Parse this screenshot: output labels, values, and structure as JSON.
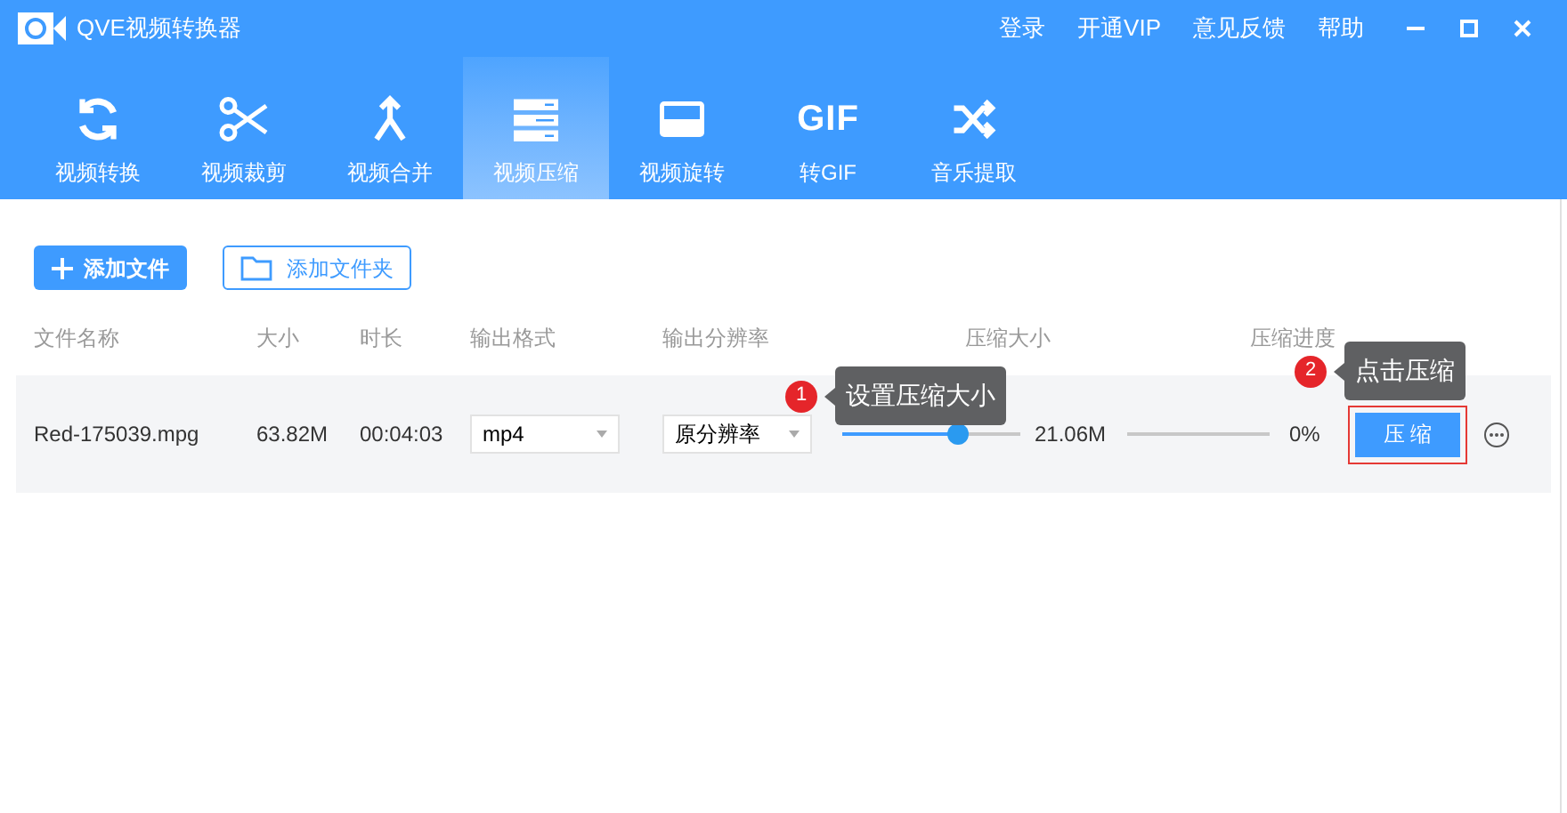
{
  "window": {
    "title": "QVE视频转换器",
    "links": [
      "登录",
      "开通VIP",
      "意见反馈",
      "帮助"
    ]
  },
  "tabs": [
    {
      "label": "视频转换",
      "kind": "convert",
      "selected": false
    },
    {
      "label": "视频裁剪",
      "kind": "cut",
      "selected": false
    },
    {
      "label": "视频合并",
      "kind": "merge",
      "selected": false
    },
    {
      "label": "视频压缩",
      "kind": "compress",
      "selected": true
    },
    {
      "label": "视频旋转",
      "kind": "rotate",
      "selected": false
    },
    {
      "label": "转GIF",
      "kind": "gif",
      "icon_text": "GIF",
      "selected": false
    },
    {
      "label": "音乐提取",
      "kind": "music",
      "selected": false
    }
  ],
  "toolbar": {
    "add_file": "添加文件",
    "add_folder": "添加文件夹"
  },
  "table": {
    "columns": [
      "文件名称",
      "大小",
      "时长",
      "输出格式",
      "输出分辨率",
      "压缩大小",
      "压缩进度"
    ],
    "rows": [
      {
        "name": "Red-175039.mpg",
        "size": "63.82M",
        "duration": "00:04:03",
        "format": "mp4",
        "resolution": "原分辨率",
        "level": 0.65,
        "compressed_size": "21.06M",
        "progress": {
          "level": 0,
          "text": "0%"
        },
        "action": "压 缩"
      }
    ]
  },
  "hints": [
    {
      "number": "1",
      "text": "设置压缩大小"
    },
    {
      "number": "2",
      "text": "点击压缩"
    }
  ]
}
